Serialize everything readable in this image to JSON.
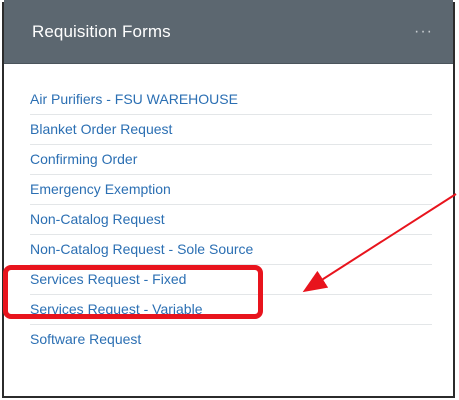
{
  "panel": {
    "title": "Requisition Forms",
    "more_label": "···"
  },
  "forms": [
    {
      "label": "Air Purifiers - FSU WAREHOUSE"
    },
    {
      "label": "Blanket Order Request"
    },
    {
      "label": "Confirming Order"
    },
    {
      "label": "Emergency Exemption"
    },
    {
      "label": "Non-Catalog Request"
    },
    {
      "label": "Non-Catalog Request - Sole Source"
    },
    {
      "label": "Services Request - Fixed"
    },
    {
      "label": "Services Request - Variable"
    },
    {
      "label": "Software Request"
    }
  ],
  "annotation": {
    "highlight_color": "#e8141d",
    "highlighted_item": "Services Request - Fixed"
  },
  "colors": {
    "header_bg": "#5c6770",
    "link": "#2b6fb3"
  }
}
